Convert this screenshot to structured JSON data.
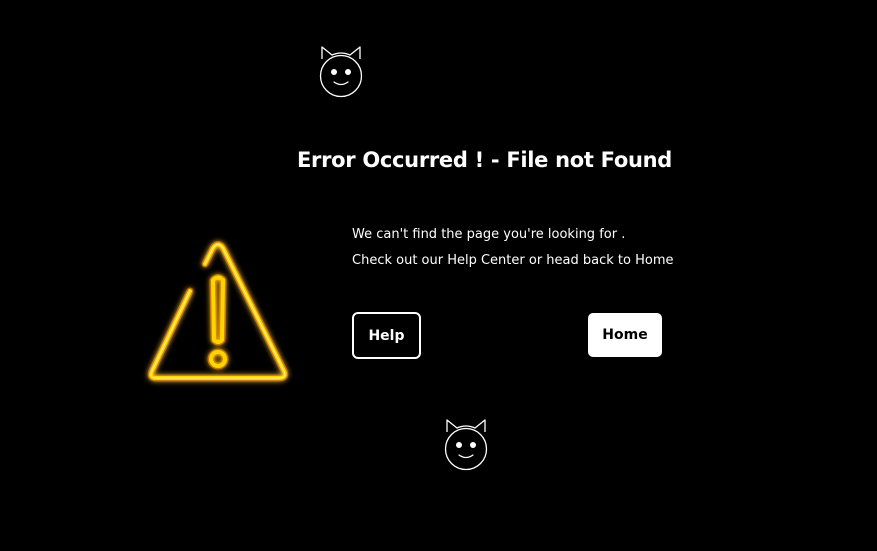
{
  "page": {
    "title": "Error Occurred ! - File not Found",
    "message_line1": "We can't find the page you're looking for .",
    "message_line2": "Check out our Help Center or head back to Home"
  },
  "buttons": {
    "help_label": "Help",
    "home_label": "Home"
  },
  "icons": {
    "top_decoration": "cat-face-icon",
    "bottom_decoration": "cat-face-icon",
    "warning": "warning-triangle-icon"
  },
  "colors": {
    "background": "#000000",
    "text": "#ffffff",
    "warning_neon": "#ffd400",
    "warning_glow": "#ff8c00"
  }
}
